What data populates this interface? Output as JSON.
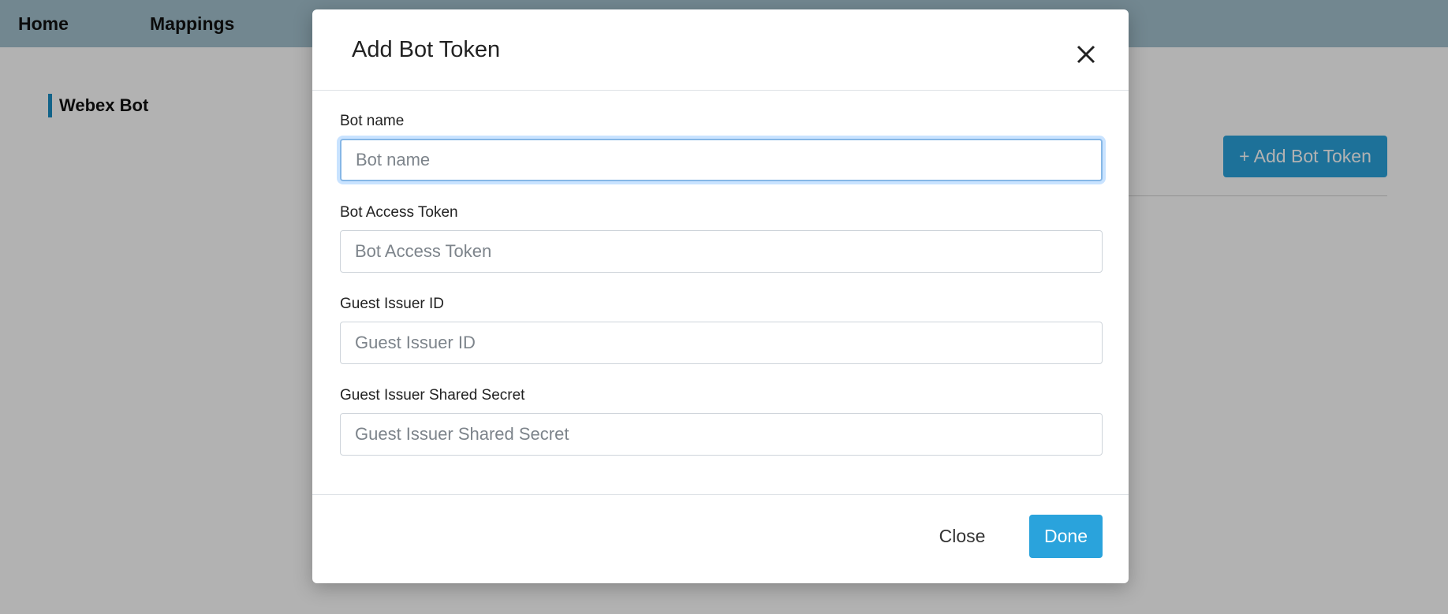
{
  "nav": {
    "home": "Home",
    "mappings": "Mappings"
  },
  "sidebar": {
    "title": "Webex Bot"
  },
  "main": {
    "add_button_label": "+ Add Bot Token"
  },
  "modal": {
    "title": "Add Bot Token",
    "fields": [
      {
        "label": "Bot name",
        "placeholder": "Bot name",
        "value": ""
      },
      {
        "label": "Bot Access Token",
        "placeholder": "Bot Access Token",
        "value": ""
      },
      {
        "label": "Guest Issuer ID",
        "placeholder": "Guest Issuer ID",
        "value": ""
      },
      {
        "label": "Guest Issuer Shared Secret",
        "placeholder": "Guest Issuer Shared Secret",
        "value": ""
      }
    ],
    "close_label": "Close",
    "done_label": "Done"
  },
  "colors": {
    "accent": "#2aa3dc",
    "nav_bg": "#a4c2ce",
    "sidebar_marker": "#1a8fc4"
  }
}
